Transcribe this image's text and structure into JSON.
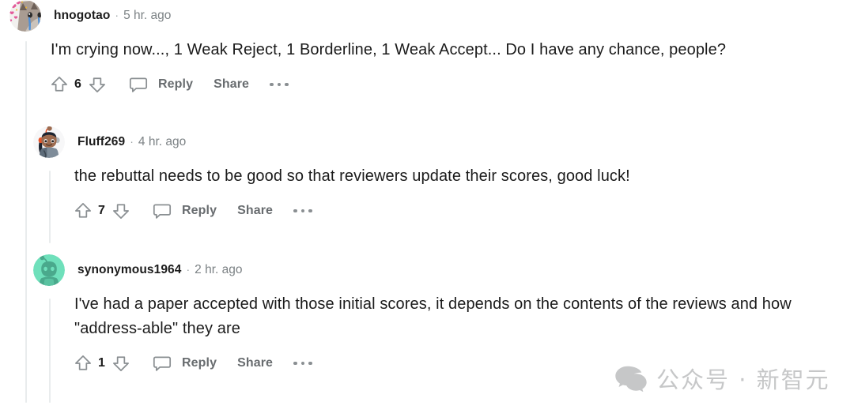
{
  "theme": {
    "background": "#ffffff",
    "text_primary": "#1b1b1b",
    "text_meta": "#7c8285",
    "action_gray": "#686c6f",
    "rail": "#e9eced",
    "watermark_gray": "#c6c7c8"
  },
  "comments": [
    {
      "username": "hnogotao",
      "separator": "·",
      "timestamp": "5 hr. ago",
      "body": "I'm crying now..., 1 Weak Reject, 1 Borderline, 1 Weak Accept... Do I have any chance, people?",
      "score": "6",
      "reply_label": "Reply",
      "share_label": "Share",
      "avatar": {
        "type": "photo-crying-cat",
        "colors": {
          "fur": "#b0a49b",
          "ear": "#6d6058",
          "tear": "#4f8fd6",
          "heart": "#e35b9a"
        }
      },
      "icons": {
        "upvote": "upvote-arrow-icon",
        "downvote": "downvote-arrow-icon",
        "comment": "comment-bubble-icon",
        "more": "more-options-icon"
      }
    },
    {
      "username": "Fluff269",
      "separator": "·",
      "timestamp": "4 hr. ago",
      "body": "the rebuttal needs to be good so that reviewers update their scores, good luck!",
      "score": "7",
      "reply_label": "Reply",
      "share_label": "Share",
      "avatar": {
        "type": "snoo-orange-headband",
        "colors": {
          "skin": "#9d6b4f",
          "headband": "#e8552a",
          "hair": "#1d2430",
          "body": "#7e8c99",
          "bg": "#f7f7f8"
        }
      },
      "icons": {
        "upvote": "upvote-arrow-icon",
        "downvote": "downvote-arrow-icon",
        "comment": "comment-bubble-icon",
        "more": "more-options-icon"
      }
    },
    {
      "username": "synonymous1964",
      "separator": "·",
      "timestamp": "2 hr. ago",
      "body": "I've had a paper accepted with those initial scores, it depends on the contents of the reviews and how \"address-able\" they are",
      "score": "1",
      "reply_label": "Reply",
      "share_label": "Share",
      "avatar": {
        "type": "snoo-green",
        "colors": {
          "bg": "#6fe0bb",
          "snoo": "#4aa98c"
        }
      },
      "icons": {
        "upvote": "upvote-arrow-icon",
        "downvote": "downvote-arrow-icon",
        "comment": "comment-bubble-icon",
        "more": "more-options-icon"
      }
    }
  ],
  "watermark": {
    "logo": "wechat-logo-icon",
    "text": "公众号 · 新智元"
  }
}
